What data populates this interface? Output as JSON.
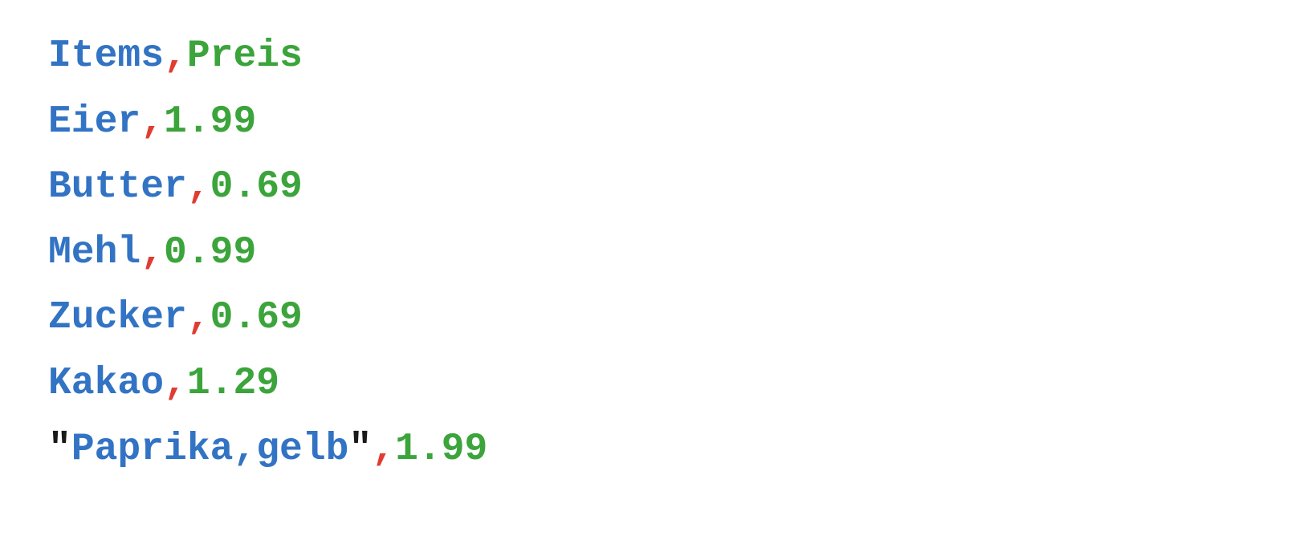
{
  "csv": {
    "lines": [
      {
        "tokens": [
          {
            "class": "blue",
            "text": "Items"
          },
          {
            "class": "red",
            "text": ","
          },
          {
            "class": "green",
            "text": "Preis"
          }
        ]
      },
      {
        "tokens": [
          {
            "class": "blue",
            "text": "Eier"
          },
          {
            "class": "red",
            "text": ","
          },
          {
            "class": "green",
            "text": "1.99"
          }
        ]
      },
      {
        "tokens": [
          {
            "class": "blue",
            "text": "Butter"
          },
          {
            "class": "red",
            "text": ","
          },
          {
            "class": "green",
            "text": "0.69"
          }
        ]
      },
      {
        "tokens": [
          {
            "class": "blue",
            "text": "Mehl"
          },
          {
            "class": "red",
            "text": ","
          },
          {
            "class": "green",
            "text": "0.99"
          }
        ]
      },
      {
        "tokens": [
          {
            "class": "blue",
            "text": "Zucker"
          },
          {
            "class": "red",
            "text": ","
          },
          {
            "class": "green",
            "text": "0.69"
          }
        ]
      },
      {
        "tokens": [
          {
            "class": "blue",
            "text": "Kakao"
          },
          {
            "class": "red",
            "text": ","
          },
          {
            "class": "green",
            "text": "1.29"
          }
        ]
      },
      {
        "tokens": [
          {
            "class": "dark",
            "text": "\""
          },
          {
            "class": "blue",
            "text": "Paprika,gelb"
          },
          {
            "class": "dark",
            "text": "\""
          },
          {
            "class": "red",
            "text": ","
          },
          {
            "class": "green",
            "text": "1.99"
          }
        ]
      }
    ]
  }
}
